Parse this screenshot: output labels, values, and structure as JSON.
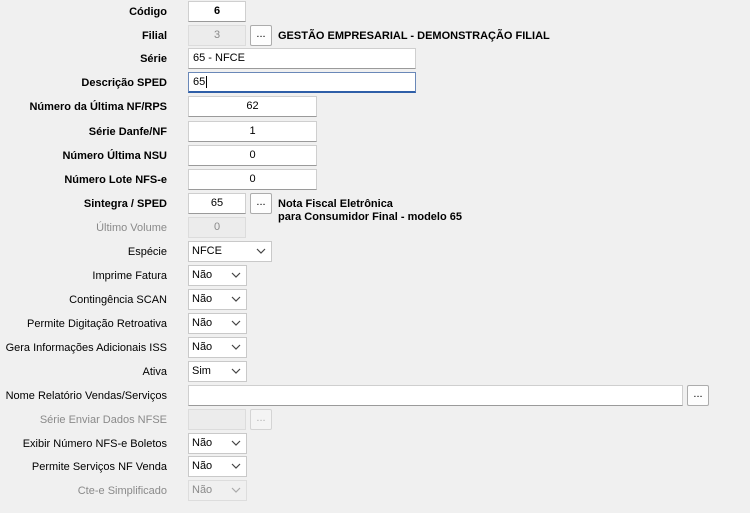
{
  "fields": {
    "codigo": {
      "label": "Código",
      "value": "6"
    },
    "filial": {
      "label": "Filial",
      "value": "3",
      "button": "...",
      "description": "GESTÃO EMPRESARIAL - DEMONSTRAÇÃO FILIAL"
    },
    "serie": {
      "label": "Série",
      "value": "65 - NFCE"
    },
    "descricao_sped": {
      "label": "Descrição SPED",
      "value": "65"
    },
    "numero_ultima_nf": {
      "label": "Número da Última NF/RPS",
      "value": "62"
    },
    "serie_danfe": {
      "label": "Série Danfe/NF",
      "value": "1"
    },
    "numero_ultima_nsu": {
      "label": "Número Última NSU",
      "value": "0"
    },
    "numero_lote_nfse": {
      "label": "Número Lote NFS-e",
      "value": "0"
    },
    "sintegra_sped": {
      "label": "Sintegra / SPED",
      "value": "65",
      "button": "...",
      "description_line1": "Nota Fiscal Eletrônica",
      "description_line2": "para Consumidor Final - modelo 65"
    },
    "ultimo_volume": {
      "label": "Último Volume",
      "value": "0"
    },
    "especie": {
      "label": "Espécie",
      "value": "NFCE"
    },
    "imprime_fatura": {
      "label": "Imprime Fatura",
      "value": "Não"
    },
    "contingencia_scan": {
      "label": "Contingência SCAN",
      "value": "Não"
    },
    "permite_digitacao_retroativa": {
      "label": "Permite Digitação Retroativa",
      "value": "Não"
    },
    "gera_info_adicionais_iss": {
      "label": "Gera Informações Adicionais ISS",
      "value": "Não"
    },
    "ativa": {
      "label": "Ativa",
      "value": "Sim"
    },
    "nome_relatorio": {
      "label": "Nome Relatório Vendas/Serviços",
      "value": "",
      "button": "..."
    },
    "serie_enviar_nfse": {
      "label": "Série Enviar Dados NFSE",
      "value": "",
      "button": "..."
    },
    "exibir_numero_nfse_boletos": {
      "label": "Exibir Número NFS-e Boletos",
      "value": "Não"
    },
    "permite_servicos_nf_venda": {
      "label": "Permite Serviços NF Venda",
      "value": "Não"
    },
    "cte_simplificado": {
      "label": "Cte-e Simplificado",
      "value": "Não"
    }
  }
}
